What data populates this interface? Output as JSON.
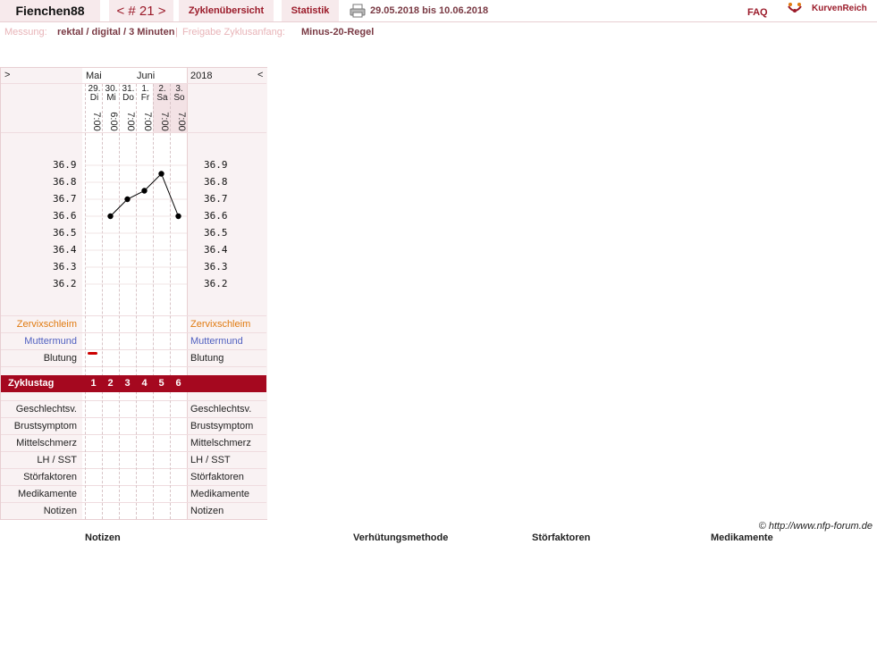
{
  "header": {
    "username": "Fienchen88",
    "cycle_nav": "< # 21 >",
    "tab_cycles": "Zyklenübersicht",
    "tab_stats": "Statistik",
    "date_range": "29.05.2018 bis 10.06.2018",
    "faq": "FAQ",
    "brand": "KurvenReich"
  },
  "meta": {
    "measure_label": "Messung:",
    "measure_value": "rektal / digital / 3 Minuten",
    "separator": "|",
    "release_label": "Freigabe Zyklusanfang:",
    "release_value": "Minus-20-Regel"
  },
  "chart_header": {
    "nav_left": ">",
    "nav_right": "<",
    "month1": "Mai",
    "month2": "Juni",
    "year": "2018"
  },
  "days": [
    {
      "date": "29.",
      "weekday": "Di",
      "time": "7:00",
      "cycle_day": "1"
    },
    {
      "date": "30.",
      "weekday": "Mi",
      "time": "6:00",
      "cycle_day": "2"
    },
    {
      "date": "31.",
      "weekday": "Do",
      "time": "7:00",
      "cycle_day": "3"
    },
    {
      "date": "1.",
      "weekday": "Fr",
      "time": "7:00",
      "cycle_day": "4"
    },
    {
      "date": "2.",
      "weekday": "Sa",
      "time": "7:00",
      "cycle_day": "5"
    },
    {
      "date": "3.",
      "weekday": "So",
      "time": "7:00",
      "cycle_day": "6"
    }
  ],
  "chart_data": {
    "type": "line",
    "x": [
      "29.",
      "30.",
      "31.",
      "1.",
      "2.",
      "3."
    ],
    "series": [
      {
        "values": [
          null,
          36.6,
          36.7,
          36.75,
          36.85,
          36.6
        ]
      }
    ],
    "yticks": [
      "36.9",
      "36.8",
      "36.7",
      "36.6",
      "36.5",
      "36.4",
      "36.3",
      "36.2"
    ],
    "ylim": [
      36.2,
      36.9
    ],
    "color": "#000000"
  },
  "rows": {
    "zervix": "Zervixschleim",
    "muttermund": "Muttermund",
    "blutung": "Blutung",
    "zyklustag": "Zyklustag",
    "geschlechtsv": "Geschlechtsv.",
    "brustsymptom": "Brustsymptom",
    "mittelschmerz": "Mittelschmerz",
    "lh": "LH / SST",
    "stoerfaktoren": "Störfaktoren",
    "medikamente": "Medikamente",
    "notizen": "Notizen"
  },
  "copyright": "© http://www.nfp-forum.de",
  "footer": {
    "notizen": "Notizen",
    "verhuetung": "Verhütungsmethode",
    "stoerfaktoren": "Störfaktoren",
    "medikamente": "Medikamente"
  },
  "colors": {
    "brand": "#9b1b2a",
    "zyklus_bar": "#a5081f",
    "bleeding": "#cc0000"
  }
}
